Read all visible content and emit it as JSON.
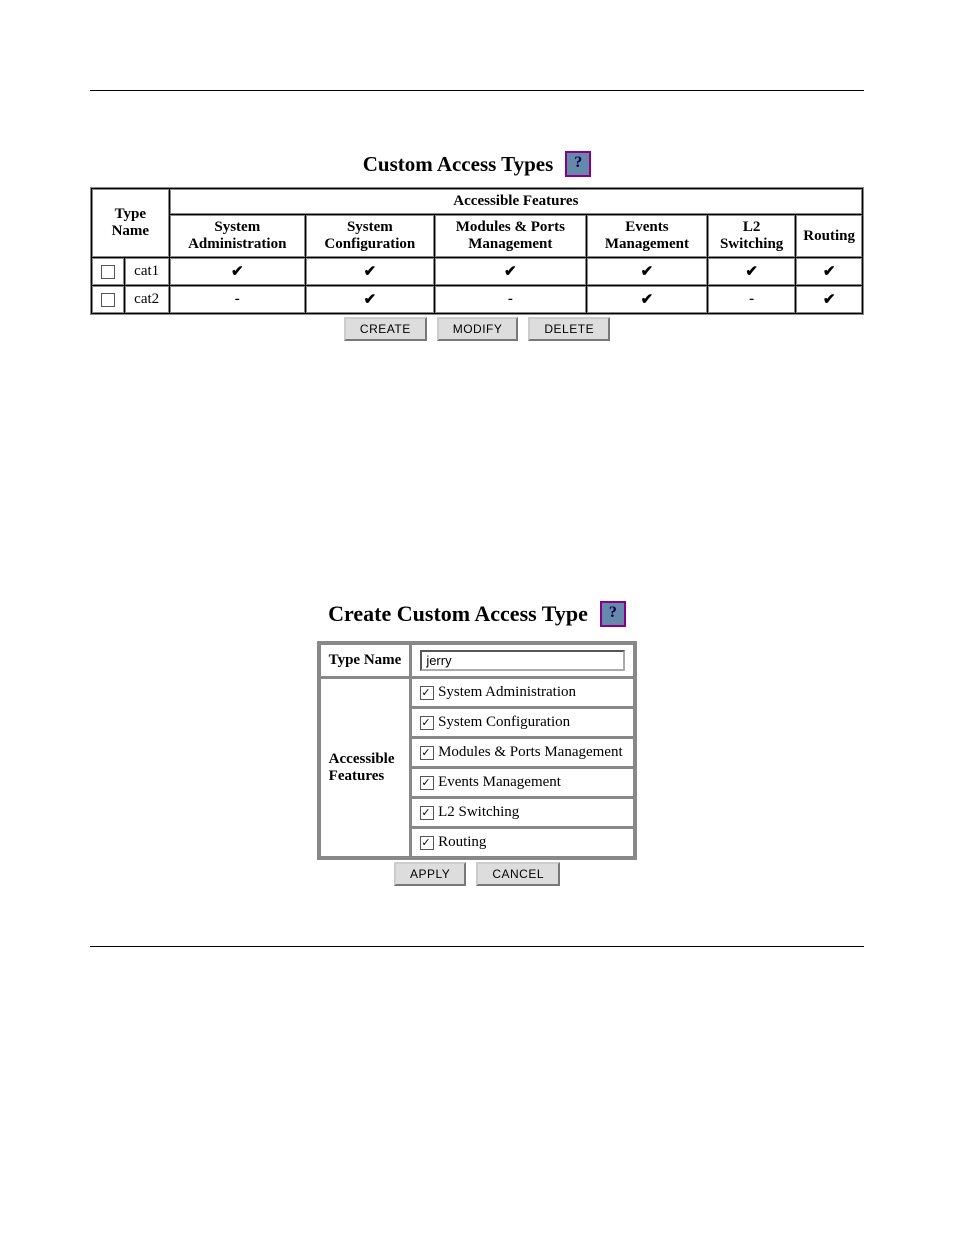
{
  "section1": {
    "title": "Custom Access Types",
    "headers": {
      "type_name": "Type Name",
      "accessible_features": "Accessible Features",
      "col1": "System Administration",
      "col2": "System Configuration",
      "col3": "Modules & Ports Management",
      "col4": "Events Management",
      "col5": "L2 Switching",
      "col6": "Routing"
    },
    "rows": [
      {
        "name": "cat1",
        "features": [
          "✔",
          "✔",
          "✔",
          "✔",
          "✔",
          "✔"
        ]
      },
      {
        "name": "cat2",
        "features": [
          "-",
          "✔",
          "-",
          "✔",
          "-",
          "✔"
        ]
      }
    ],
    "buttons": {
      "create": "CREATE",
      "modify": "MODIFY",
      "delete": "DELETE"
    }
  },
  "section2": {
    "title": "Create Custom Access Type",
    "labels": {
      "type_name": "Type Name",
      "accessible_features": "Accessible Features"
    },
    "type_name_value": "jerry",
    "features": [
      "System Administration",
      "System Configuration",
      "Modules & Ports Management",
      "Events Management",
      "L2 Switching",
      "Routing"
    ],
    "buttons": {
      "apply": "APPLY",
      "cancel": "CANCEL"
    }
  }
}
